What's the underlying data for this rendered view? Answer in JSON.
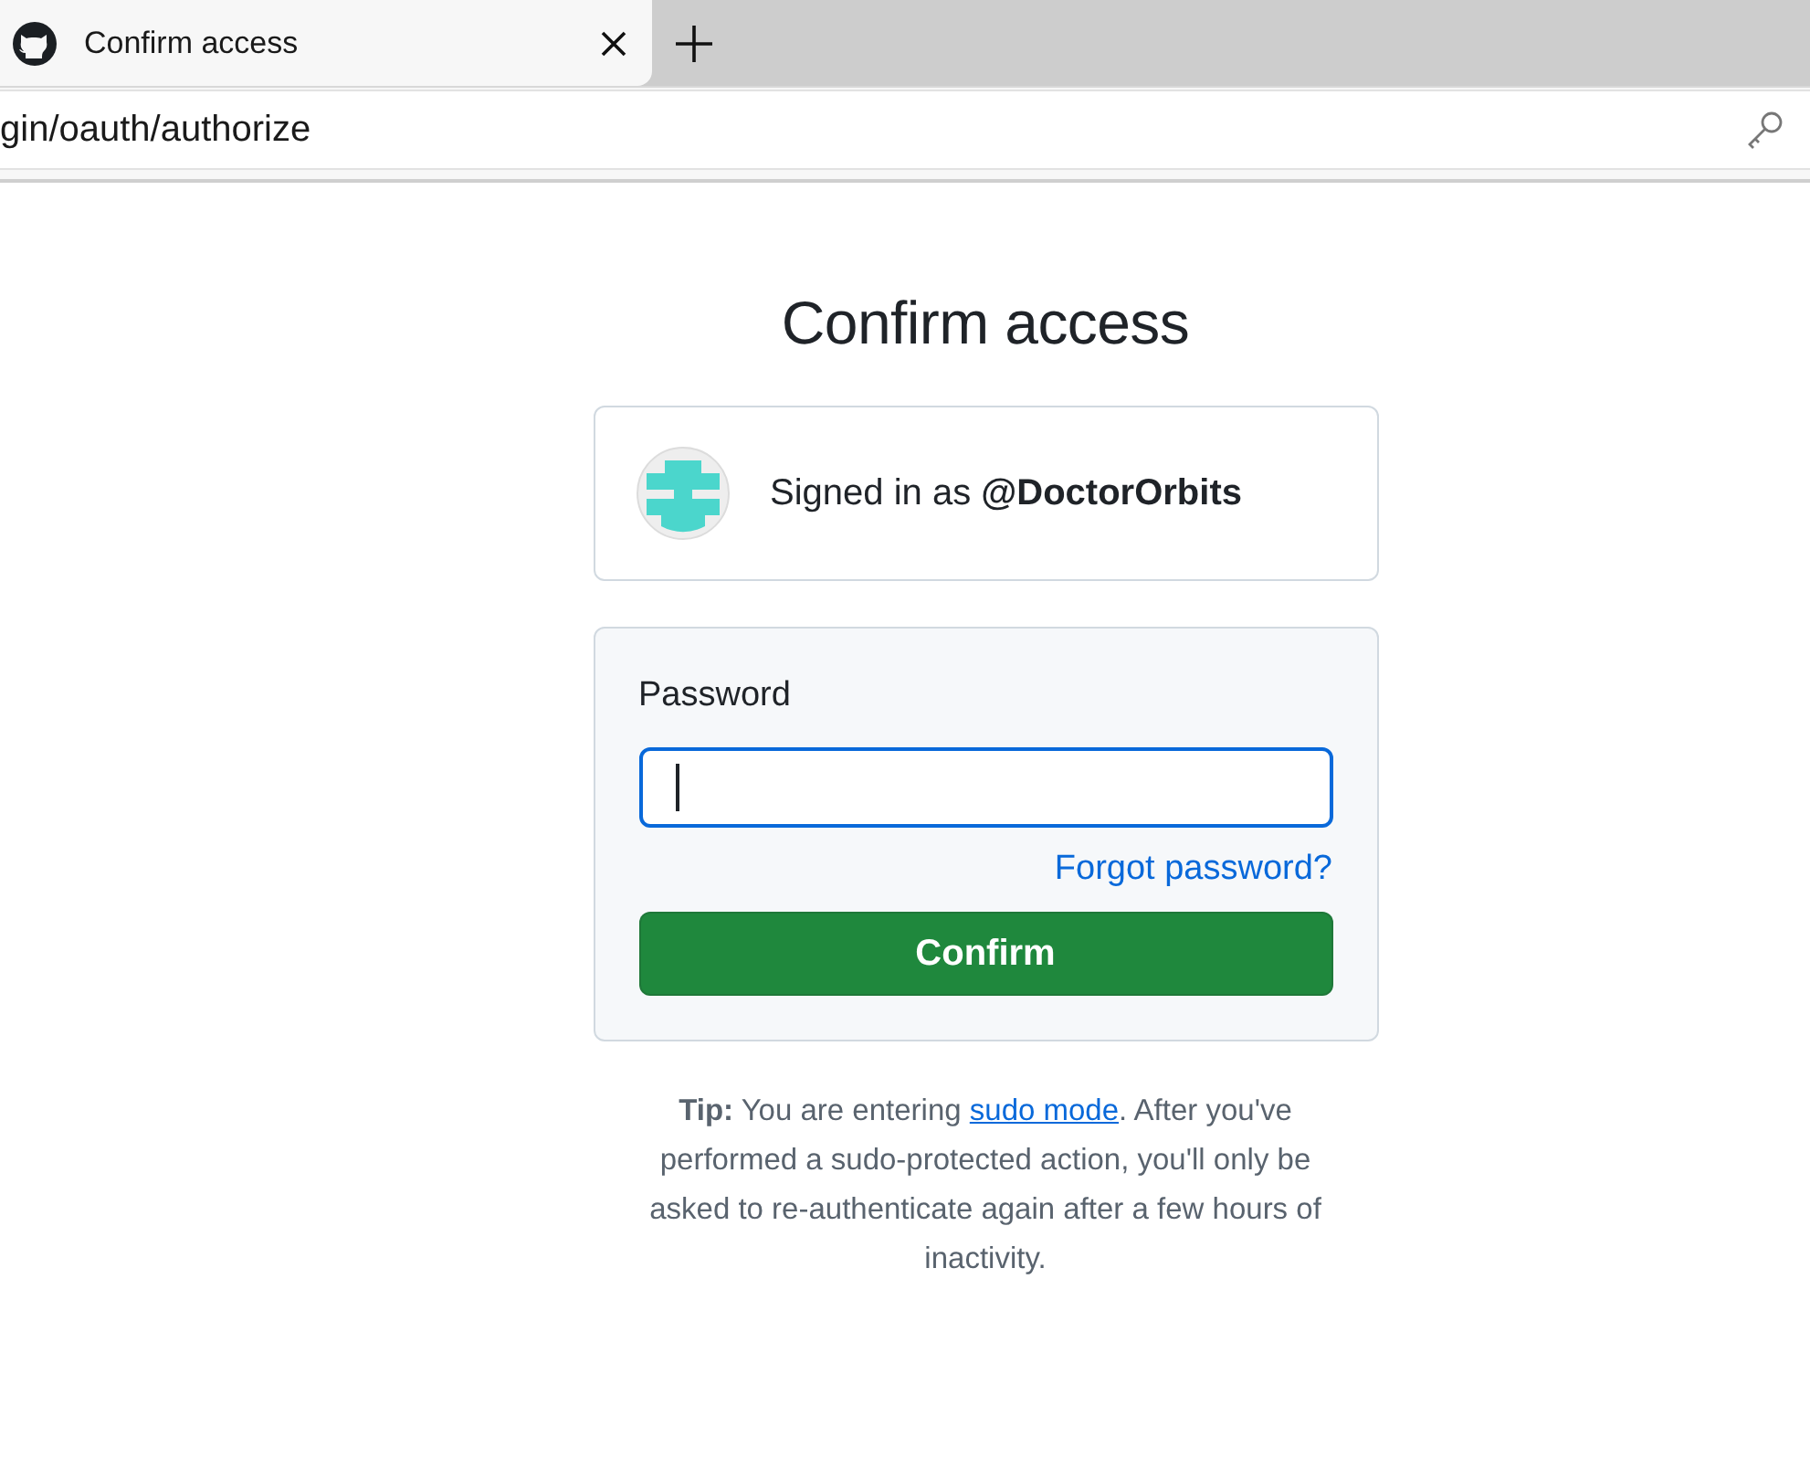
{
  "browser": {
    "tab": {
      "title": "Confirm access",
      "selected": true
    },
    "address": "gin/oauth/authorize"
  },
  "page": {
    "title": "Confirm access",
    "account": {
      "prefix": "Signed in as ",
      "username": "@DoctorOrbits"
    },
    "form": {
      "label": "Password",
      "password": {
        "focused": true
      },
      "forgot_link": "Forgot password?",
      "confirm_button": "Confirm"
    },
    "tip": {
      "before": "**Tip:** You are entering ",
      "link": "sudo mode",
      "after": ". After you've performed a sudo-protected action, you'll only be asked to re-authenticate again after a few hours of inactivity."
    }
  }
}
